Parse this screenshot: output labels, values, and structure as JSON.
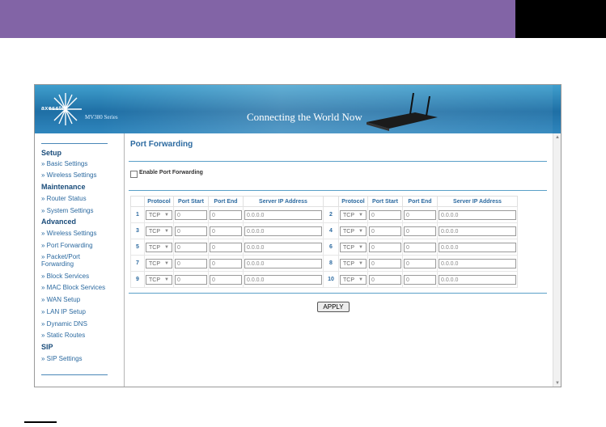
{
  "banner": {
    "logo_text": "axesstel",
    "series": "MV380 Series",
    "tagline": "Connecting the World Now"
  },
  "sidebar": {
    "sections": [
      {
        "heading": "Setup",
        "items": [
          "» Basic Settings",
          "» Wireless Settings"
        ]
      },
      {
        "heading": "Maintenance",
        "items": [
          "» Router Status",
          "» System Settings"
        ]
      },
      {
        "heading": "Advanced",
        "items": [
          "» Wireless Settings",
          "» Port Forwarding",
          "» Packet/Port Forwarding",
          "» Block Services",
          "» MAC Block Services",
          "» WAN Setup",
          "» LAN IP Setup",
          "» Dynamic DNS",
          "» Static Routes"
        ]
      },
      {
        "heading": "SIP",
        "items": [
          "» SIP Settings"
        ]
      }
    ]
  },
  "main": {
    "title": "Port Forwarding",
    "enable_label": "Enable Port Forwarding",
    "enable_checked": false,
    "columns": [
      "Protocol",
      "Port Start",
      "Port End",
      "Server IP Address"
    ],
    "rows": [
      {
        "left": {
          "num": "1",
          "protocol": "TCP",
          "start": "0",
          "end": "0",
          "ip": "0.0.0.0"
        },
        "right": {
          "num": "2",
          "protocol": "TCP",
          "start": "0",
          "end": "0",
          "ip": "0.0.0.0"
        }
      },
      {
        "left": {
          "num": "3",
          "protocol": "TCP",
          "start": "0",
          "end": "0",
          "ip": "0.0.0.0"
        },
        "right": {
          "num": "4",
          "protocol": "TCP",
          "start": "0",
          "end": "0",
          "ip": "0.0.0.0"
        }
      },
      {
        "left": {
          "num": "5",
          "protocol": "TCP",
          "start": "0",
          "end": "0",
          "ip": "0.0.0.0"
        },
        "right": {
          "num": "6",
          "protocol": "TCP",
          "start": "0",
          "end": "0",
          "ip": "0.0.0.0"
        }
      },
      {
        "left": {
          "num": "7",
          "protocol": "TCP",
          "start": "0",
          "end": "0",
          "ip": "0.0.0.0"
        },
        "right": {
          "num": "8",
          "protocol": "TCP",
          "start": "0",
          "end": "0",
          "ip": "0.0.0.0"
        }
      },
      {
        "left": {
          "num": "9",
          "protocol": "TCP",
          "start": "0",
          "end": "0",
          "ip": "0.0.0.0"
        },
        "right": {
          "num": "10",
          "protocol": "TCP",
          "start": "0",
          "end": "0",
          "ip": "0.0.0.0"
        }
      }
    ],
    "apply_label": "APPLY"
  },
  "colors": {
    "top_bar": "#8264a6",
    "banner_blue": "#1f6fa5",
    "link_blue": "#2c6aa0",
    "heading_navy": "#1a4c7a"
  },
  "icons": {
    "logo": "starburst-logo-icon",
    "router": "router-device-icon",
    "dropdown": "chevron-down-icon"
  }
}
